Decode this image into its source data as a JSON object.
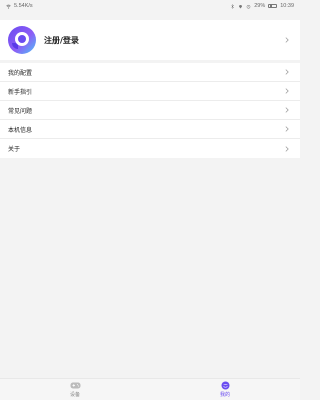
{
  "status_bar": {
    "network_speed": "5.54K/s",
    "battery_percent": "29%",
    "time": "10:39"
  },
  "profile": {
    "avatar_icon": "app-logo-icon",
    "label": "注册/登录"
  },
  "menu": {
    "items": [
      {
        "label": "我的配置"
      },
      {
        "label": "新手指引"
      },
      {
        "label": "常见问题"
      },
      {
        "label": "本机信息"
      },
      {
        "label": "关于"
      }
    ]
  },
  "tabs": [
    {
      "label": "设备",
      "icon": "gamepad-icon",
      "active": false
    },
    {
      "label": "我的",
      "icon": "profile-face-icon",
      "active": true
    }
  ],
  "colors": {
    "accent": "#6a4cf0",
    "background": "#f3f3f3",
    "card": "#ffffff"
  }
}
